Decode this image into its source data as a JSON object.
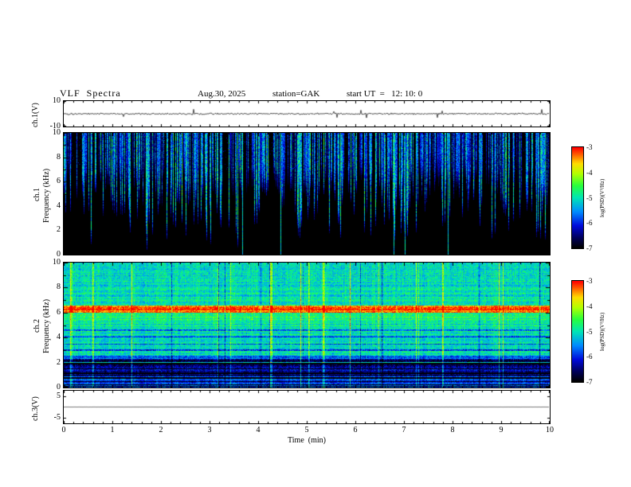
{
  "header": {
    "title": "VLF  Spectra",
    "date": "Aug.30, 2025",
    "station": "station=GAK",
    "start_ut": "start UT  =   12: 10: 0"
  },
  "xaxis": {
    "label": "Time  (min)",
    "ticks": [
      "0",
      "1",
      "2",
      "3",
      "4",
      "5",
      "6",
      "7",
      "8",
      "9",
      "10"
    ]
  },
  "colorbar": {
    "label": "log(PSD)(V²/Hz)",
    "ticks": [
      "-3",
      "-4",
      "-5",
      "-6",
      "-7"
    ]
  },
  "panels": {
    "ch1_wave": {
      "ylabel": "ch.1(V)",
      "yticks": [
        "10",
        "-10"
      ]
    },
    "ch1_spec": {
      "channel": "ch.1",
      "ylabel": "Frequency (kHz)",
      "yticks": [
        "10",
        "8",
        "6",
        "4",
        "2",
        "0"
      ]
    },
    "ch2_spec": {
      "channel": "ch.2",
      "ylabel": "Frequency (kHz)",
      "yticks": [
        "10",
        "8",
        "6",
        "4",
        "2",
        "0"
      ]
    },
    "ch3_wave": {
      "ylabel": "ch.3(V)",
      "yticks": [
        "5",
        "-5"
      ]
    }
  },
  "chart_data": [
    {
      "type": "line",
      "name": "ch1_waveform",
      "ylabel": "ch.1(V)",
      "xlabel": "Time (min)",
      "xlim": [
        0,
        10
      ],
      "ylim": [
        -10,
        10
      ],
      "yticks": [
        10,
        -10
      ],
      "description": "Broadband noise trace centered at 0 V, ~±1 V fluctuations with sparse spikes to about ±3 V over the full 10 minutes",
      "gen": {
        "seed": 101,
        "noise_v": 0.8,
        "spike_prob": 0.012,
        "spike_v": 2.5,
        "color": "#000000"
      }
    },
    {
      "type": "heatmap",
      "name": "ch1_spectrogram",
      "channel": "ch.1",
      "ylabel": "Frequency (kHz)",
      "xlabel": "Time (min)",
      "xlim": [
        0,
        10
      ],
      "ylim": [
        0,
        10
      ],
      "zlim": [
        -7,
        -3
      ],
      "zlabel": "log(PSD)(V²/Hz)",
      "description": "Mostly at the -7 noise floor (black). Dense vertical sferic streaks descend from 10 kHz; typical streaks reach 4-7 kHz at -6 to -5 (dark blue/blue); sporadic intense streaks span the full 0-10 kHz at about -5 to -4.5 (cyan/green).",
      "gen": {
        "seed": 202,
        "active_prob": 0.58,
        "full_line_prob": 0.018,
        "ambient_prob": 0.05
      }
    },
    {
      "type": "heatmap",
      "name": "ch2_spectrogram",
      "channel": "ch.2",
      "ylabel": "Frequency (kHz)",
      "xlabel": "Time (min)",
      "xlim": [
        0,
        10
      ],
      "ylim": [
        0,
        10
      ],
      "zlim": [
        -7,
        -3
      ],
      "zlabel": "log(PSD)(V²/Hz)",
      "description": "Continuous structured noise: green/cyan field (-5.5 to -4.5) above 2.5 kHz, intense red/orange band at 6.0-6.6 kHz peaking near 6.3 kHz (~ -3.3), dark blue band 0.9-2.0 kHz (~ -6.6), striped near-black rows below ~1 kHz, thin dark horizontal lines mid-band, and frequent red vertical streaks crossing all frequencies.",
      "gen": {
        "seed": 303,
        "base_z": -5.5,
        "bands": [
          {
            "f_lo": 6.05,
            "f_hi": 6.6,
            "dz": 2.0,
            "peak_f": 6.3,
            "peak_dz": 0.3
          },
          {
            "f_lo": 5.1,
            "f_hi": 6.05,
            "dz": 0.7
          },
          {
            "f_lo": 6.6,
            "f_hi": 10.0,
            "dz": 0.45
          },
          {
            "f_lo": 2.6,
            "f_hi": 5.1,
            "dz": 0.5
          },
          {
            "f_lo": 2.1,
            "f_hi": 2.6,
            "dz": -0.3
          },
          {
            "f_lo": 0.9,
            "f_hi": 2.0,
            "dz": -1.1
          },
          {
            "f_lo": 0.0,
            "f_hi": 0.9,
            "dz": -0.5
          }
        ],
        "dark_lines": [
          2.25,
          3.05,
          3.5,
          4.1,
          4.6
        ],
        "stripe_below_f": 2.3,
        "streak_prob": 0.03,
        "streak_dz": 1.4,
        "dark_col_prob": 0.02,
        "row_noise": 0.5,
        "col_noise": 0.35,
        "pix_noise": 0.8
      }
    },
    {
      "type": "line",
      "name": "ch3_waveform",
      "ylabel": "ch.3(V)",
      "xlabel": "Time (min)",
      "xlim": [
        0,
        10
      ],
      "ylim": [
        -7.5,
        7.5
      ],
      "yticks": [
        5,
        -5
      ],
      "description": "Flat trace at 0 V for the full 10 minutes",
      "gen": {
        "seed": 404,
        "noise_v": 0.03,
        "spike_prob": 0,
        "spike_v": 0,
        "color": "#444444"
      }
    }
  ]
}
